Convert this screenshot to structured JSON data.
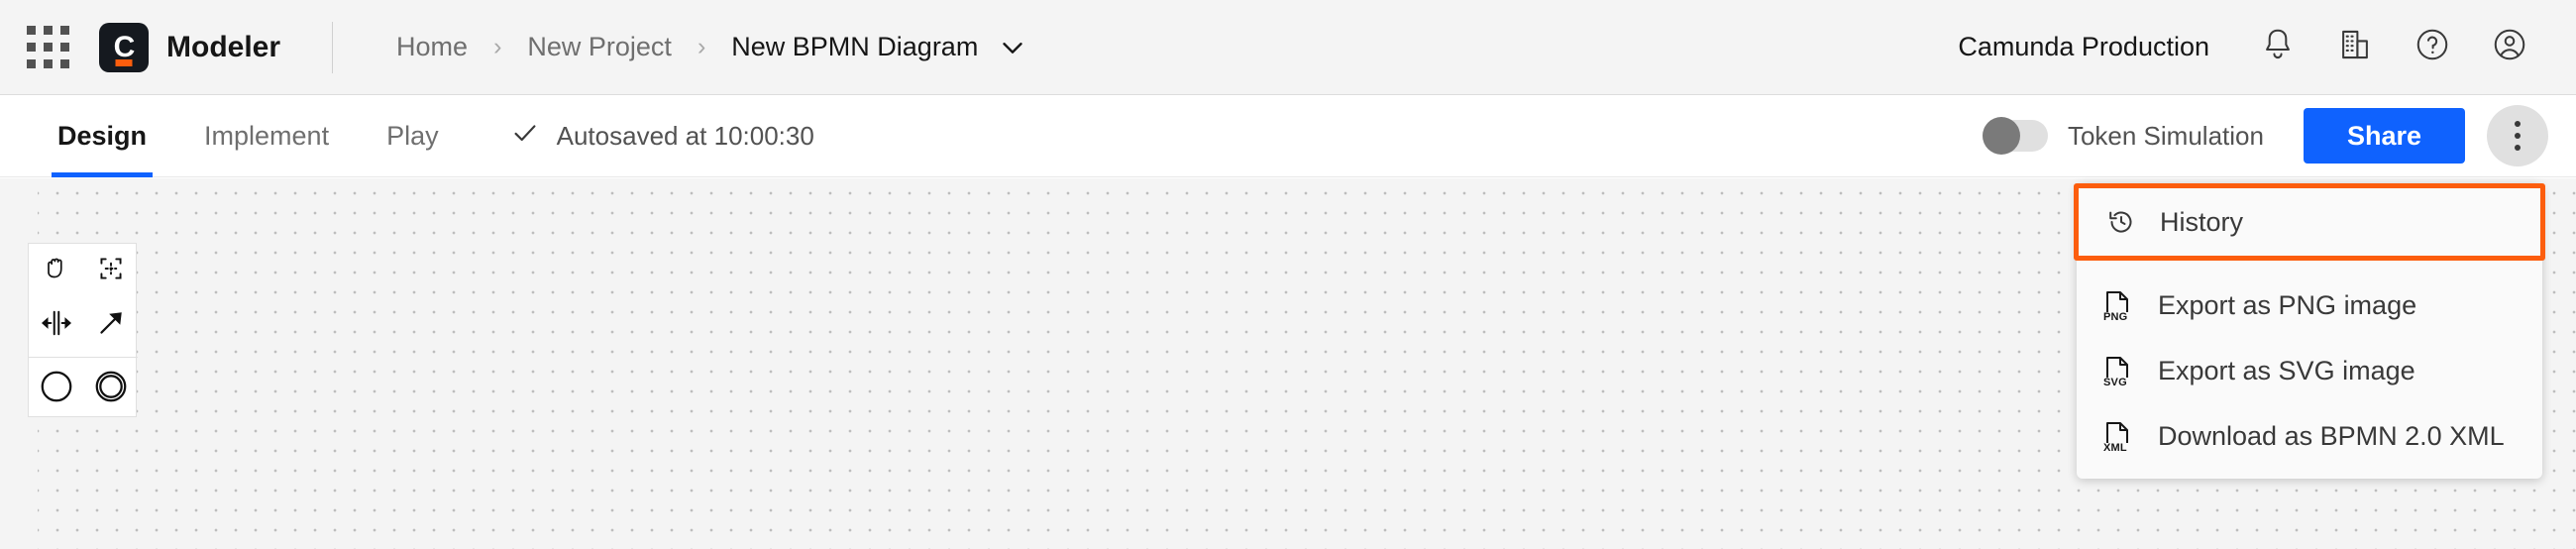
{
  "header": {
    "apps_icon": "apps-grid-icon",
    "product_name": "Modeler",
    "logo_letter": "C",
    "breadcrumb": [
      {
        "label": "Home",
        "current": false
      },
      {
        "label": "New Project",
        "current": false
      },
      {
        "label": "New BPMN Diagram",
        "current": true
      }
    ],
    "breadcrumb_separator": "›",
    "org_name": "Camunda Production",
    "icons": [
      {
        "name": "notifications-bell-icon"
      },
      {
        "name": "organization-building-icon"
      },
      {
        "name": "help-question-icon"
      },
      {
        "name": "user-account-icon"
      }
    ]
  },
  "toolbar": {
    "tabs": [
      {
        "label": "Design",
        "active": true
      },
      {
        "label": "Implement",
        "active": false
      },
      {
        "label": "Play",
        "active": false
      }
    ],
    "autosave_status": "Autosaved at 10:00:30",
    "autosave_icon": "checkmark-icon",
    "token_simulation_label": "Token Simulation",
    "token_simulation_on": false,
    "share_label": "Share",
    "more_menu_icon": "kebab-menu-icon"
  },
  "menu": {
    "items": [
      {
        "label": "History",
        "icon": "history-clock-icon",
        "highlighted": true
      },
      {
        "label": "Export as PNG image",
        "icon": "file-png-icon",
        "tag": "PNG",
        "highlighted": false
      },
      {
        "label": "Export as SVG image",
        "icon": "file-svg-icon",
        "tag": "SVG",
        "highlighted": false
      },
      {
        "label": "Download as BPMN 2.0 XML",
        "icon": "file-xml-icon",
        "tag": "XML",
        "highlighted": false
      }
    ]
  },
  "palette": {
    "tools": [
      {
        "name": "hand-tool-icon"
      },
      {
        "name": "lasso-tool-icon"
      },
      {
        "name": "space-tool-icon"
      },
      {
        "name": "connect-tool-icon"
      },
      {
        "name": "start-event-icon"
      },
      {
        "name": "intermediate-event-icon"
      }
    ]
  },
  "colors": {
    "brand_orange": "#fc5d0d",
    "accent_blue": "#0f62fe",
    "header_bg": "#f4f4f4",
    "canvas_bg": "#f4f4f4",
    "text_primary": "#161616",
    "text_secondary": "#6f6f6f"
  }
}
